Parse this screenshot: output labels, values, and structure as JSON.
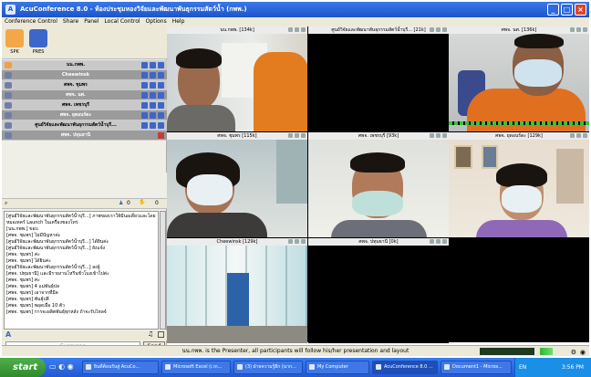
{
  "window": {
    "title": "AcuConference 8.0 - ห้องประชุมหองวิจัยและพัฒนาพันธุกรรมสัตว์น้ำ (กพพ.)"
  },
  "menu": [
    "Conference Control",
    "Share",
    "Panel",
    "Local Control",
    "Options",
    "Help"
  ],
  "toolbar": {
    "spk": "SPK",
    "pres": "PRES"
  },
  "participants": [
    "นน.กพพ.",
    "Cheewinsk",
    "ศพจ. ชุมพร",
    "ศพจ. นศ.",
    "ศพจ. เพชรบุรี",
    "ศพจ. ยุดอนร์ดะ",
    "ศูนย์วิจัยและพัฒนาพันธุกรรมสัตว์น้ำบุรี...",
    "ศพจ. ปทุมธานี"
  ],
  "chat_counts": {
    "hands": "0",
    "mics": "0"
  },
  "chat_messages": [
    "[ศูนย์วิจัยและพัฒนาพันธุกรรมสัตว์น้ำบุรี...] ภาพของเราให้มีนอเดี่ยวและโดย",
    "หมอเทคร์ Launch ในเครื่องของโทร่",
    "[นน.กพพ.] ขอบ",
    "[ศพจ. ชุมพร] ไม่มีปัญหาค่ะ",
    "[ศูนย์วิจัยและพัฒนาพันธุกรรมสัตว์น้ำบุรี...] ได้ยินค่ะ",
    "[ศูนย์วิจัยและพัฒนาพันธุกรรมสัตว์น้ำบุรี...] ยังแจ้ง",
    "[ศพจ. ชุมพร] ค่ะ",
    "[ศพจ. ชุมพร] ได้ยินค่ะ",
    "[ศูนย์วิจัยและพัฒนาพันธุกรรมสัตว์น้ำบุรี...] ลงผู้",
    "[ศพจ. ปทุมธานี] และมีรายงานโหรีนชั่วโมงเข้าไปค่ะ",
    "[ศพจ. ชุมพร] ค่ะ",
    "[ศพจ. ชุมพร] 4 แม่พันธุ์ปล",
    "[ศพจ. ชุมพร] เอาจากที่มีล",
    "[ศพจ. ชุมพร] พันธุ์ปลี",
    "[ศพจ. ชุมพร] พอุดเมื่อ 10 ตัว",
    "[ศพจ. ชุมพร] การจะผลิตพันธุ์ทุกหลัง ถ้าจะรับไหลจ์"
  ],
  "chat_input": {
    "placeholder": "Everyone",
    "send": "Send"
  },
  "tiles": [
    {
      "label": "นน.กพพ. [134k]"
    },
    {
      "label": "ศูนย์วิจัยและพัฒนาพันธุกรรมสัตว์น้ำบุรี... [21k]"
    },
    {
      "label": "ศพจ. นศ. [136k]"
    },
    {
      "label": "ศพจ. ชุมพร [115k]"
    },
    {
      "label": "ศพจ. เพชรบุรี [93k]"
    },
    {
      "label": "ศพจ. ยุดอนร์ดะ [129k]"
    },
    {
      "label": "Cheewinsk [129k]"
    },
    {
      "label": "ศพจ. ปทุมธานี [0k]"
    }
  ],
  "status": "นน.กพพ. is the Presenter, all participants will follow his/her presentation and layout",
  "taskbar": {
    "start": "start",
    "tasks": [
      "ยินดีต้อนรับสู่ AcuCo...",
      "Microsoft Excel (เวก...",
      "(3) ฝ่ายความรู้ยีก (นาก...",
      "My Computer",
      "AcuConference 8.0 ...",
      "Document1 - Micros..."
    ],
    "clock": "3:56 PM",
    "lang": "EN"
  }
}
